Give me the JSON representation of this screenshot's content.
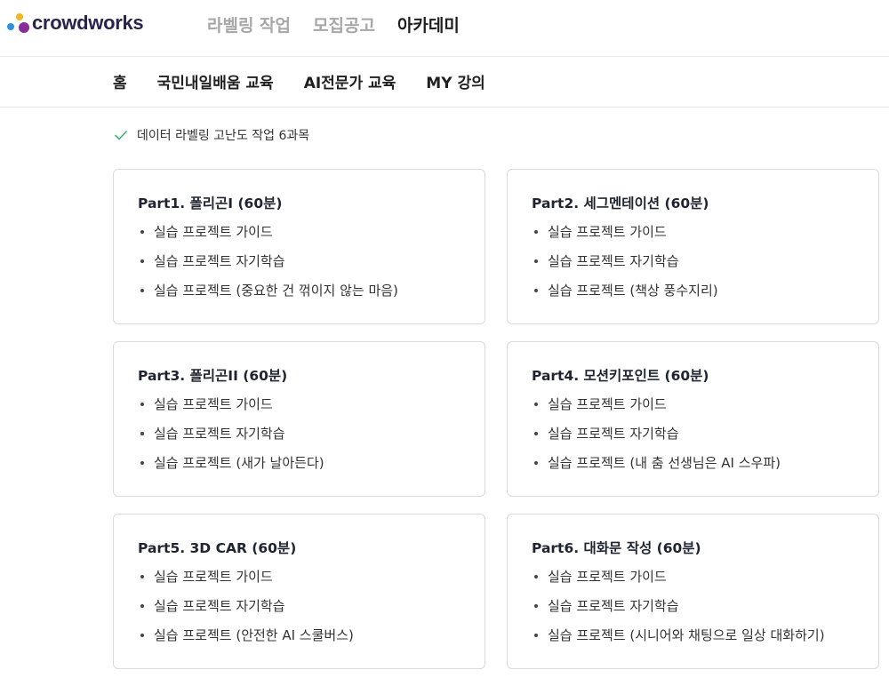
{
  "header": {
    "logo_text": "crowdworks",
    "nav": [
      {
        "label": "라벨링 작업",
        "active": false
      },
      {
        "label": "모집공고",
        "active": false
      },
      {
        "label": "아카데미",
        "active": true
      }
    ]
  },
  "subnav": [
    "홈",
    "국민내일배움 교육",
    "AI전문가 교육",
    "MY 강의"
  ],
  "notice": "데이터 라벨링 고난도 작업 6과목",
  "colors": {
    "check": "#3db37a",
    "logo_primary": "#2a2350",
    "logo_dot_purple": "#8a2d9a",
    "logo_dot_yellow": "#f2b61e",
    "logo_dot_blue": "#2f8fe0"
  },
  "courses": [
    {
      "title": "Part1. 폴리곤I (60분)",
      "items": [
        "실습 프로젝트 가이드",
        "실습 프로젝트 자기학습",
        "실습 프로젝트 (중요한 건 꺾이지 않는 마음)"
      ]
    },
    {
      "title": "Part2. 세그멘테이션 (60분)",
      "items": [
        "실습 프로젝트 가이드",
        "실습 프로젝트 자기학습",
        "실습 프로젝트 (책상 풍수지리)"
      ]
    },
    {
      "title": "Part3. 폴리곤II (60분)",
      "items": [
        "실습 프로젝트 가이드",
        "실습 프로젝트 자기학습",
        "실습 프로젝트 (새가 날아든다)"
      ]
    },
    {
      "title": "Part4. 모션키포인트 (60분)",
      "items": [
        "실습 프로젝트 가이드",
        "실습 프로젝트 자기학습",
        "실습 프로젝트 (내 춤 선생님은 AI 스우파)"
      ]
    },
    {
      "title": "Part5. 3D CAR (60분)",
      "items": [
        "실습 프로젝트 가이드",
        "실습 프로젝트 자기학습",
        "실습 프로젝트 (안전한 AI 스쿨버스)"
      ]
    },
    {
      "title": "Part6. 대화문 작성 (60분)",
      "items": [
        "실습 프로젝트 가이드",
        "실습 프로젝트 자기학습",
        "실습 프로젝트 (시니어와 채팅으로 일상 대화하기)"
      ]
    }
  ]
}
